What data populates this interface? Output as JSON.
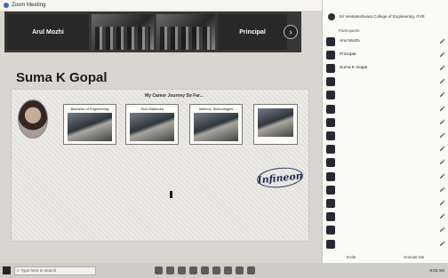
{
  "window": {
    "title": "Zoom Meeting"
  },
  "gallery": {
    "tiles": [
      {
        "name": "Arul Mozhi",
        "video": false
      },
      {
        "name": "",
        "video": true
      },
      {
        "name": "",
        "video": true
      },
      {
        "name": "Principal",
        "video": false
      }
    ],
    "next_icon": "chevron-right-icon"
  },
  "presenter": {
    "name": "Suma K Gopal"
  },
  "slide": {
    "heading": "My Career Journey So Far...",
    "cards": [
      {
        "caption": "Bachelor of Engineering"
      },
      {
        "caption": "Tech Mahindra"
      },
      {
        "caption": "Infineon Technologies"
      },
      {
        "caption": ""
      }
    ],
    "logo": "Infineon"
  },
  "participants_panel": {
    "header_line1": "Sri Venkateshwara College of Engineering, GVE",
    "header_line2": "Participants",
    "participants": [
      {
        "name": "Arul Mozhi"
      },
      {
        "name": "Principal"
      },
      {
        "name": "Suma K Gopal"
      },
      {
        "name": ""
      },
      {
        "name": ""
      },
      {
        "name": ""
      },
      {
        "name": ""
      },
      {
        "name": ""
      },
      {
        "name": ""
      },
      {
        "name": ""
      },
      {
        "name": ""
      },
      {
        "name": ""
      },
      {
        "name": ""
      },
      {
        "name": ""
      },
      {
        "name": ""
      },
      {
        "name": ""
      }
    ],
    "footer": {
      "invite": "Invite",
      "unmute": "Unmute Me"
    }
  },
  "taskbar": {
    "search_placeholder": "Type here to search",
    "time": "9:03 AM"
  }
}
